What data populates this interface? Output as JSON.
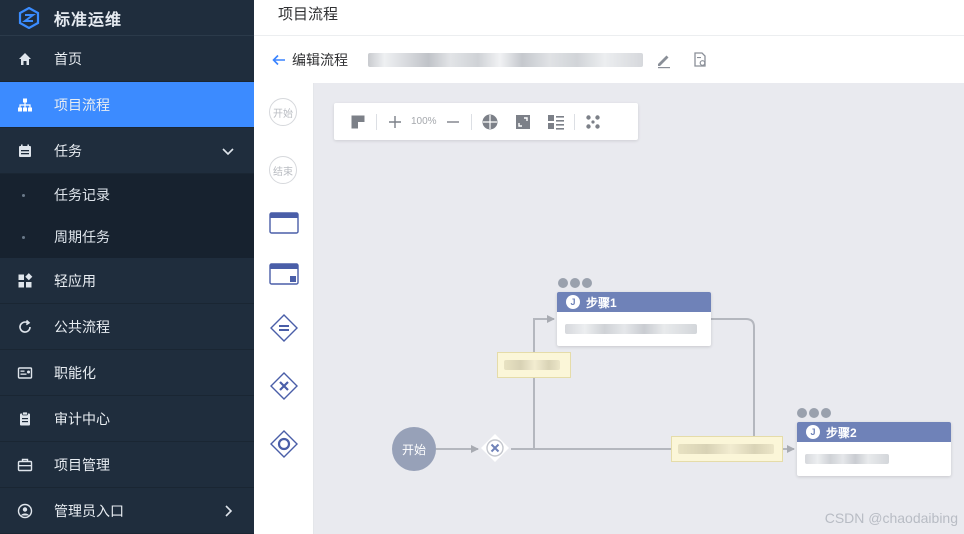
{
  "brand": {
    "name": "标准运维"
  },
  "sidebar": {
    "items": [
      {
        "label": "首页",
        "icon": "home-icon"
      },
      {
        "label": "项目流程",
        "icon": "sitemap-icon",
        "active": true
      },
      {
        "label": "任务",
        "icon": "calendar-icon",
        "expanded": true
      },
      {
        "label": "轻应用",
        "icon": "apps-icon"
      },
      {
        "label": "公共流程",
        "icon": "refresh-icon"
      },
      {
        "label": "职能化",
        "icon": "id-card-icon"
      },
      {
        "label": "审计中心",
        "icon": "clipboard-icon"
      },
      {
        "label": "项目管理",
        "icon": "briefcase-icon"
      },
      {
        "label": "管理员入口",
        "icon": "user-circle-icon"
      }
    ],
    "sub_items": [
      {
        "label": "任务记录"
      },
      {
        "label": "周期任务"
      }
    ]
  },
  "header": {
    "title": "项目流程"
  },
  "subbar": {
    "back_label": "编辑流程"
  },
  "palette": {
    "start_label": "开始",
    "end_label": "结束"
  },
  "toolbar": {
    "zoom": "100%"
  },
  "canvas": {
    "start_node": "开始",
    "steps": [
      {
        "title": "步骤1",
        "badge": "J"
      },
      {
        "title": "步骤2",
        "badge": "J"
      }
    ]
  },
  "watermark": "CSDN @chaodaibing",
  "colors": {
    "sidebar_bg": "#1f2d3d",
    "active": "#3c8bff",
    "node_head": "#6f82b8",
    "canvas_bg": "#e9eaef"
  }
}
